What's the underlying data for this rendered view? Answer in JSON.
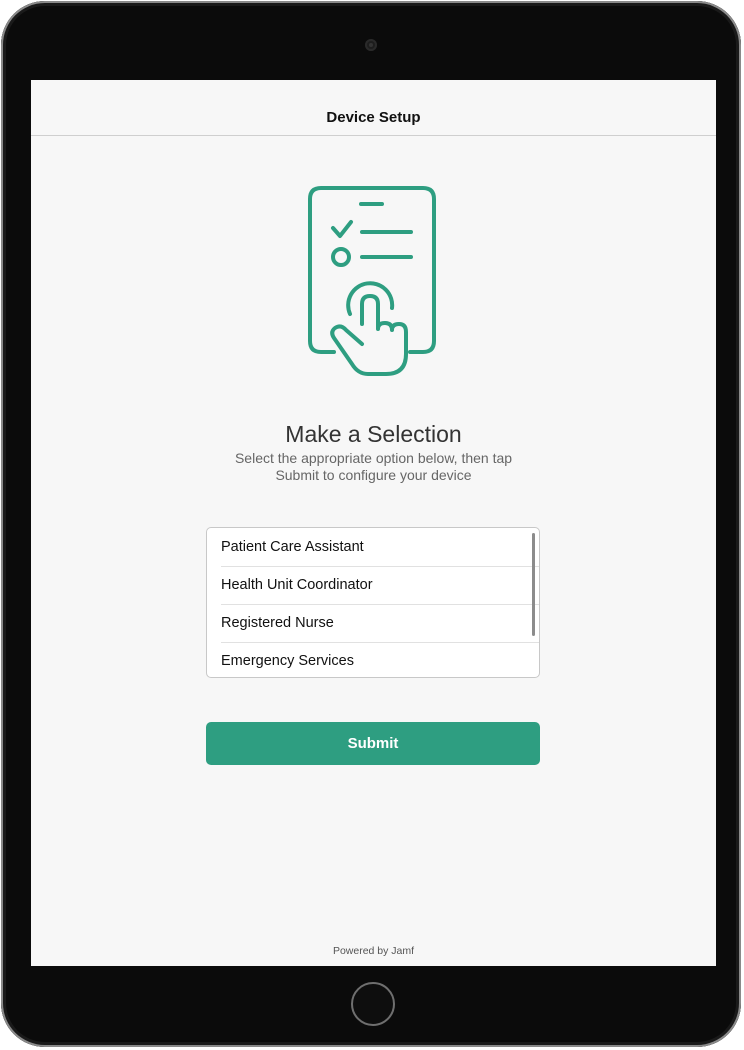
{
  "device": {
    "camera_icon": "front-camera",
    "home_button_icon": "home-button-ring"
  },
  "nav": {
    "title": "Device Setup"
  },
  "hero": {
    "icon": "checklist-clipboard-tap-icon",
    "color": "#2e9e81"
  },
  "content": {
    "headline": "Make a Selection",
    "subtext_line1": "Select the appropriate option below, then tap",
    "subtext_line2": "Submit to configure your device"
  },
  "options": {
    "items": [
      {
        "label": "Patient Care Assistant"
      },
      {
        "label": "Health Unit Coordinator"
      },
      {
        "label": "Registered Nurse"
      },
      {
        "label": "Emergency Services"
      }
    ]
  },
  "actions": {
    "submit_label": "Submit",
    "accent_color": "#2e9e81"
  },
  "footer": {
    "text": "Powered by Jamf"
  }
}
